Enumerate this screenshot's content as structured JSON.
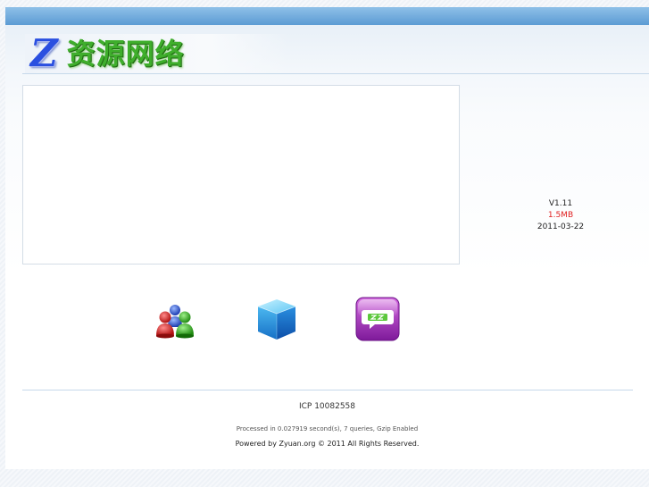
{
  "header": {
    "logo_letter": "Z",
    "logo_text": "资源网络"
  },
  "info": {
    "version": "V1.11",
    "size": "1.5MB",
    "date": "2011-03-22"
  },
  "icons": [
    {
      "name": "users-icon"
    },
    {
      "name": "cube-icon"
    },
    {
      "name": "chat-icon"
    }
  ],
  "footer": {
    "icp": "ICP 10082558",
    "processed": "Processed in 0.027919 second(s), 7 queries, Gzip Enabled",
    "powered": "Powered by Zyuan.org © 2011 All Rights Reserved."
  },
  "colors": {
    "top_bar": "#5c9bd4",
    "logo_z": "#2a4fe0",
    "logo_text": "#3fae2c",
    "size_text": "#e02020"
  }
}
